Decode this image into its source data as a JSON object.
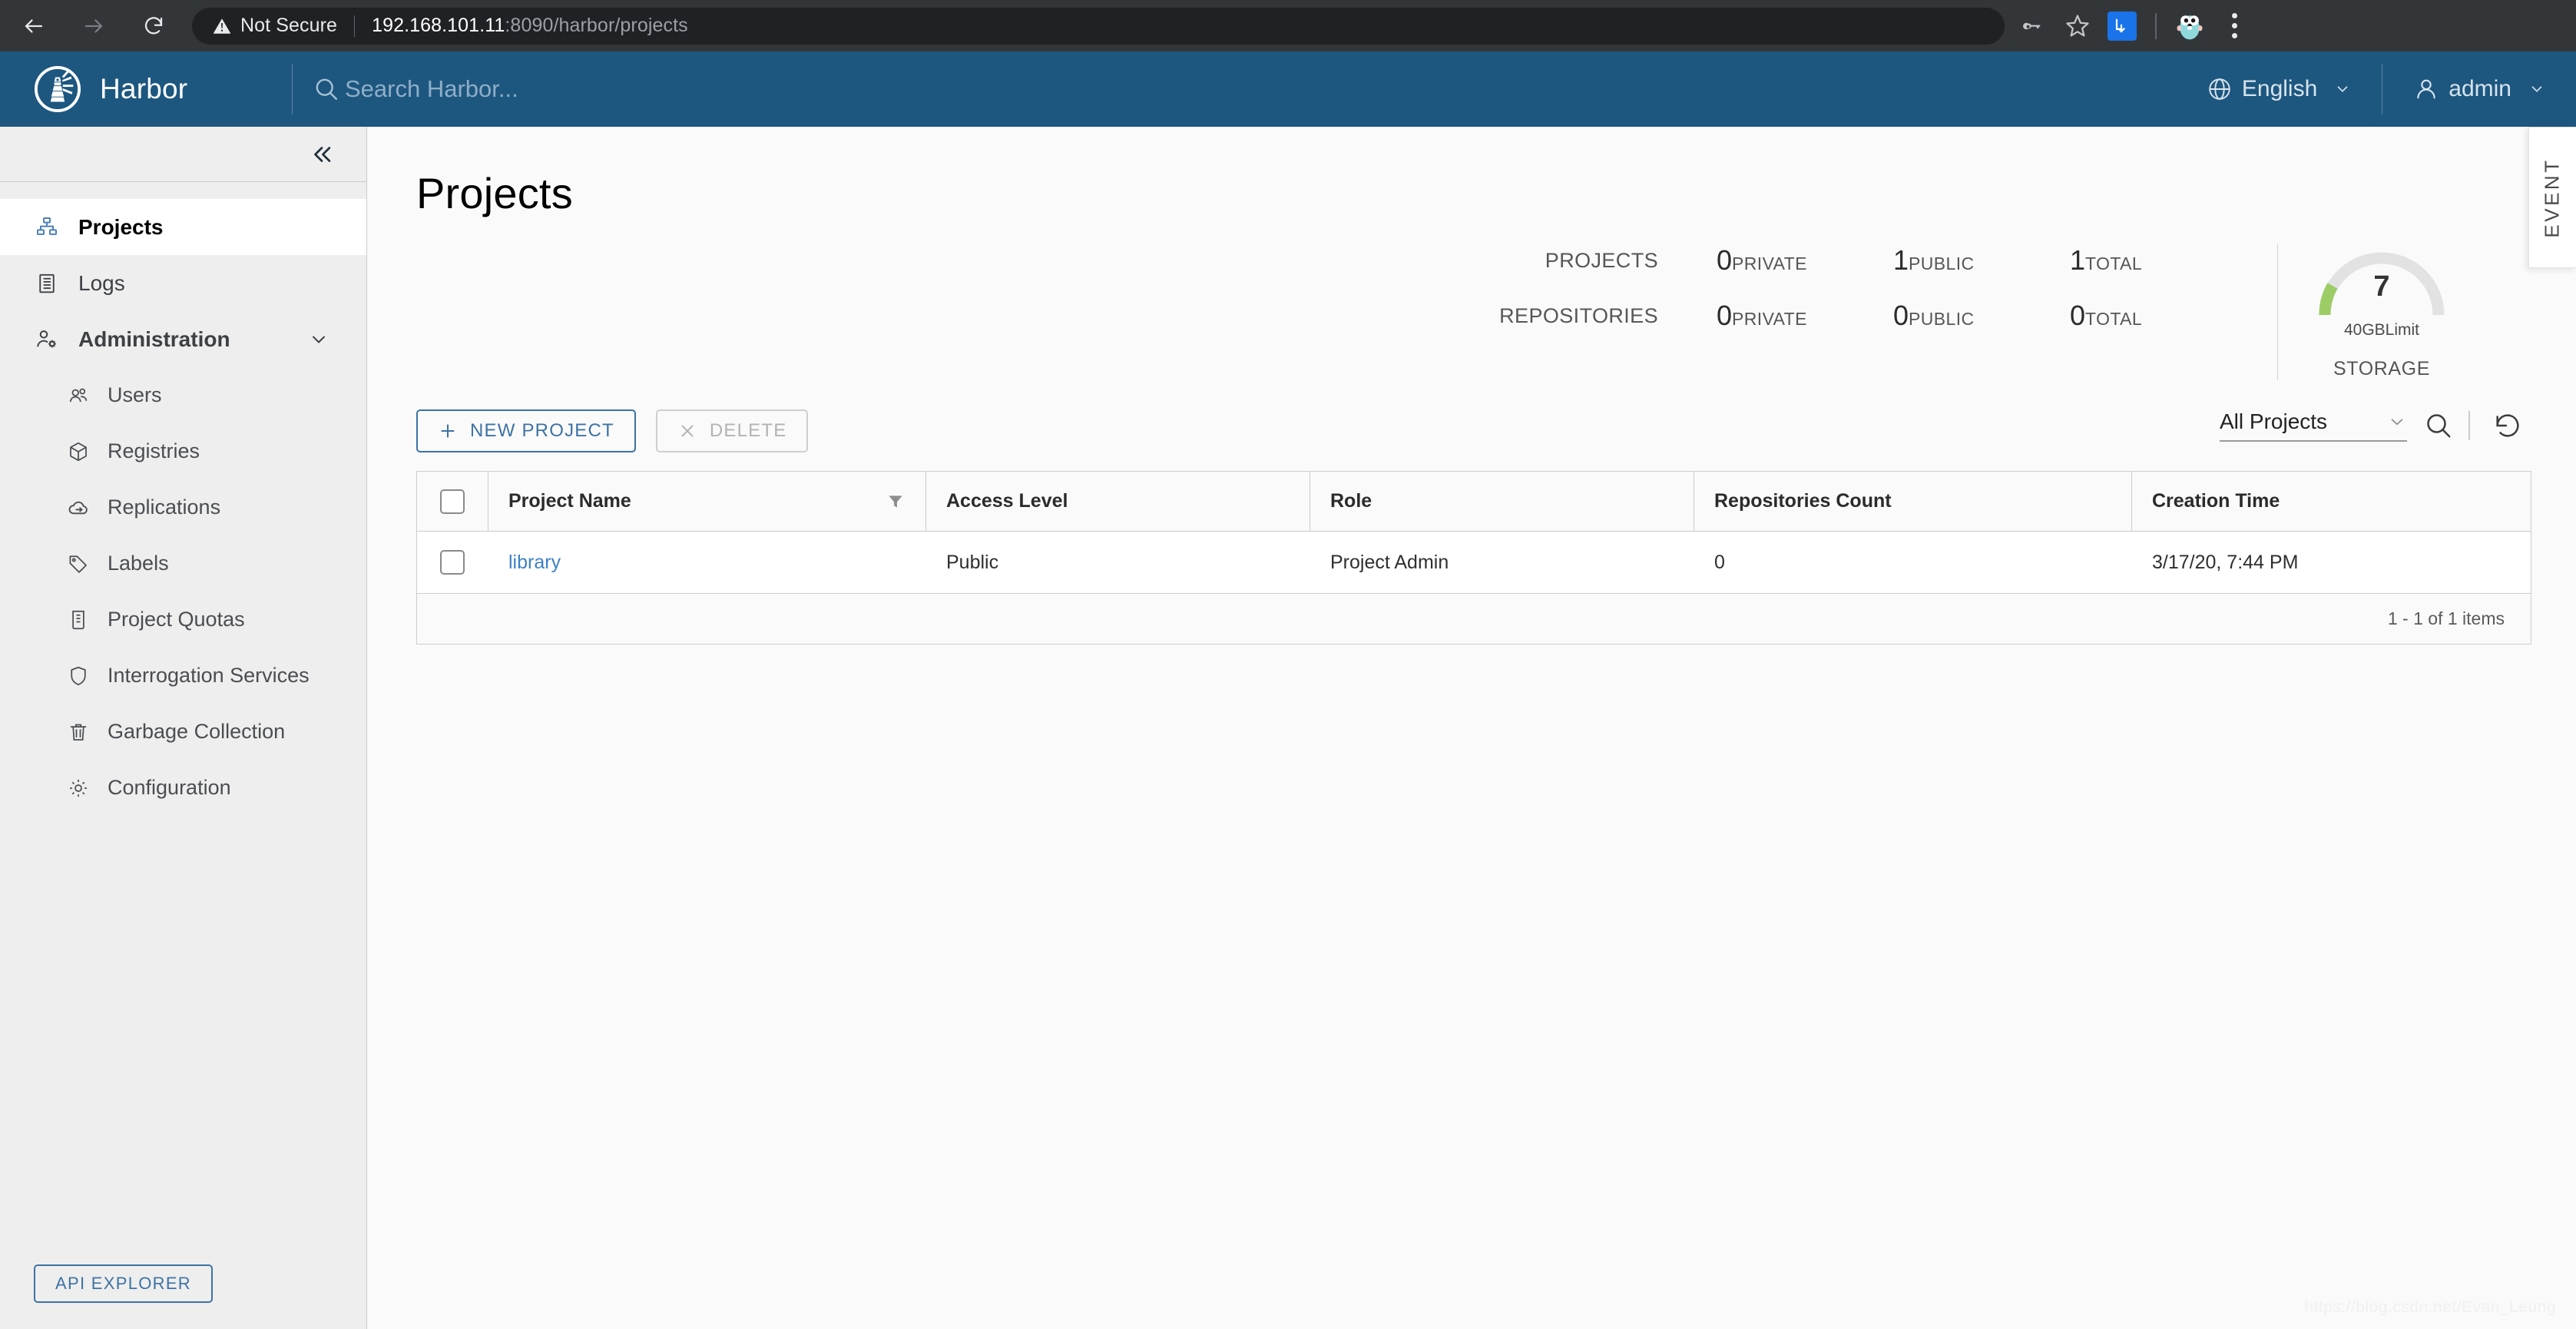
{
  "browser": {
    "back_icon": "arrow-left-icon",
    "forward_icon": "arrow-right-icon",
    "reload_icon": "reload-icon",
    "security_label": "Not Secure",
    "url_host": "192.168.101.11",
    "url_path": ":8090/harbor/projects",
    "icons": {
      "password_key": "key-icon",
      "bookmark_star": "star-icon",
      "extension": "extension-icon",
      "profile_avatar": "gopher-avatar-icon",
      "menu": "kebab-menu-icon"
    }
  },
  "header": {
    "brand": "Harbor",
    "logo_icon": "harbor-lighthouse-logo",
    "search_placeholder": "Search Harbor...",
    "search_value": "",
    "language": "English",
    "language_icon": "globe-icon",
    "user": "admin",
    "user_icon": "user-icon"
  },
  "sidebar": {
    "collapse_icon": "double-chevron-left-icon",
    "items": [
      {
        "label": "Projects",
        "icon": "projects-icon",
        "active": true
      },
      {
        "label": "Logs",
        "icon": "logs-icon",
        "active": false
      },
      {
        "label": "Administration",
        "icon": "administration-icon",
        "group": true,
        "expanded": true
      }
    ],
    "admin_children": [
      {
        "label": "Users",
        "icon": "users-icon"
      },
      {
        "label": "Registries",
        "icon": "registries-cube-icon"
      },
      {
        "label": "Replications",
        "icon": "replications-cloud-icon"
      },
      {
        "label": "Labels",
        "icon": "labels-tag-icon"
      },
      {
        "label": "Project Quotas",
        "icon": "project-quotas-beaker-icon"
      },
      {
        "label": "Interrogation Services",
        "icon": "shield-icon"
      },
      {
        "label": "Garbage Collection",
        "icon": "trash-icon"
      },
      {
        "label": "Configuration",
        "icon": "gear-icon"
      }
    ],
    "api_explorer": "API EXPLORER"
  },
  "main": {
    "title": "Projects",
    "statistics": {
      "rows": [
        {
          "label": "PROJECTS",
          "cells": [
            {
              "value": "0",
              "unit": "PRIVATE"
            },
            {
              "value": "1",
              "unit": "PUBLIC"
            },
            {
              "value": "1",
              "unit": "TOTAL"
            }
          ]
        },
        {
          "label": "REPOSITORIES",
          "cells": [
            {
              "value": "0",
              "unit": "PRIVATE"
            },
            {
              "value": "0",
              "unit": "PUBLIC"
            },
            {
              "value": "0",
              "unit": "TOTAL"
            }
          ]
        }
      ],
      "storage": {
        "value": "7",
        "limit": "40GBLimit",
        "caption": "STORAGE",
        "arc_color": "#9ccc65",
        "track_color": "#e0e0e0",
        "percent": 17
      }
    },
    "toolbar": {
      "new_project": "NEW PROJECT",
      "new_project_icon": "plus-icon",
      "delete": "DELETE",
      "delete_icon": "close-x-icon",
      "delete_disabled": true,
      "filter_select": "All Projects",
      "select_chevron_icon": "chevron-down-icon",
      "search_icon": "search-icon",
      "refresh_icon": "refresh-icon"
    },
    "table": {
      "select_all_checkbox": "select-all-checkbox",
      "columns": [
        "Project Name",
        "Access Level",
        "Role",
        "Repositories Count",
        "Creation Time"
      ],
      "name_filter_icon": "filter-funnel-icon",
      "rows": [
        {
          "name": "library",
          "access_level": "Public",
          "role": "Project Admin",
          "repositories_count": "0",
          "creation_time": "3/17/20, 7:44 PM"
        }
      ],
      "pagination": "1 - 1 of 1 items"
    },
    "event_tab": "EVENT",
    "watermark": "https://blog.csdn.net/Evan_Leung"
  },
  "colors": {
    "header_bg": "#1d5780",
    "accent_blue": "#3d72a4",
    "link_blue": "#3d82c4",
    "sidebar_bg": "#eeeeee",
    "content_bg": "#fafafa",
    "gauge_green": "#9ccc65"
  }
}
